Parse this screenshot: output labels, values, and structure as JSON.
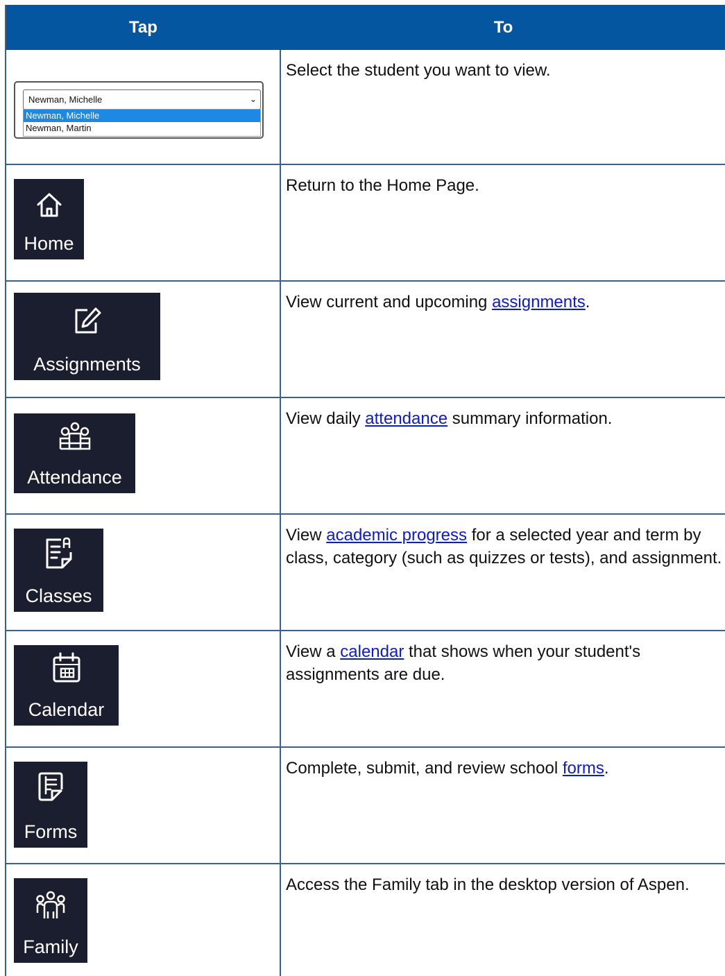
{
  "header": {
    "col_tap": "Tap",
    "col_to": "To"
  },
  "student_select": {
    "selected": "Newman, Michelle",
    "options": [
      "Newman, Michelle",
      "Newman, Martin"
    ],
    "description": "Select the student you want to view."
  },
  "rows": {
    "home": {
      "label": "Home",
      "icon": "home-icon",
      "description": "Return to the Home Page."
    },
    "assignments": {
      "label": "Assignments",
      "icon": "edit-pencil-icon",
      "desc_before": "View current and upcoming ",
      "link": "assignments",
      "desc_after": "."
    },
    "attendance": {
      "label": "Attendance",
      "icon": "people-group-icon",
      "desc_before": "View daily ",
      "link": "attendance",
      "desc_after": " summary information."
    },
    "classes": {
      "label": "Classes",
      "icon": "document-grade-icon",
      "desc_before": "View ",
      "link": "academic progress",
      "desc_after": " for a selected year and term by class, category (such as quizzes or tests), and assignment."
    },
    "calendar": {
      "label": "Calendar",
      "icon": "calendar-icon",
      "desc_before": "View a ",
      "link": "calendar",
      "desc_after": " that shows when your student's assignments are due."
    },
    "forms": {
      "label": "Forms",
      "icon": "form-list-icon",
      "desc_before": "Complete, submit, and review school ",
      "link": "forms",
      "desc_after": "."
    },
    "family": {
      "label": "Family",
      "icon": "family-icon",
      "description": "Access the Family tab in the desktop version of Aspen."
    }
  },
  "colors": {
    "header_bg": "#0456a0",
    "tile_bg": "#1b1e2e",
    "link": "#0b19d8",
    "grid": "#3d5f8c"
  }
}
